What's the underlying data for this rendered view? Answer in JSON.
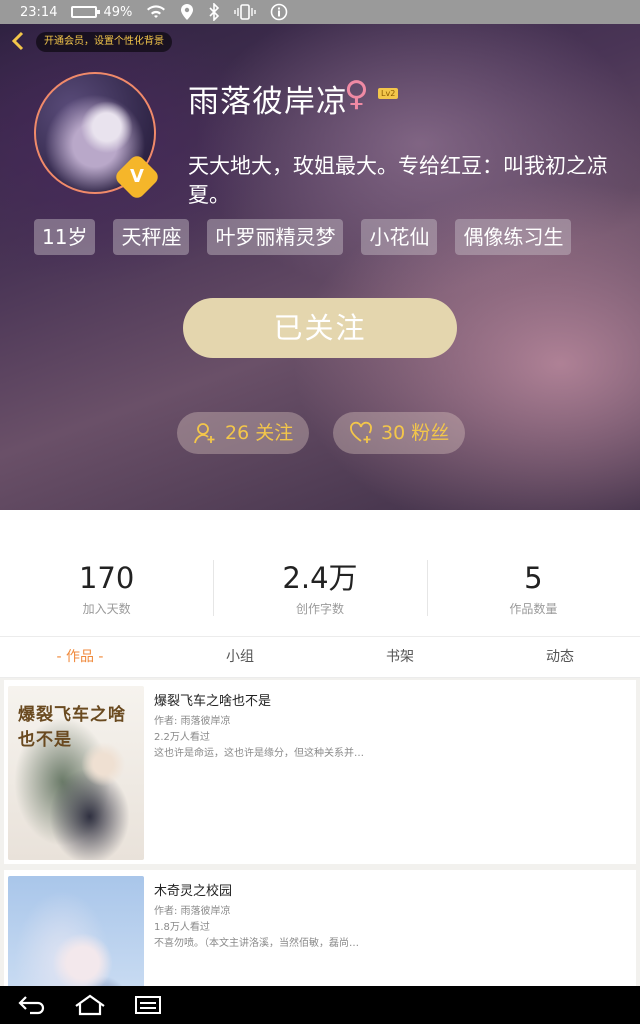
{
  "status_bar": {
    "time": "23:14",
    "battery_percent": "49%",
    "battery_level": 0.49,
    "icons": [
      "battery-icon",
      "wifi-icon",
      "location-icon",
      "bluetooth-icon",
      "vibrate-icon",
      "info-icon"
    ]
  },
  "header": {
    "vip_tip": "开通会员，设置个性化背景",
    "username": "雨落彼岸凉",
    "gender_symbol": "♀",
    "level": "Lv2",
    "bio": "天大地大，玫姐最大。专给红豆：叫我初之凉夏。",
    "tags": [
      "11岁",
      "天秤座",
      "叶罗丽精灵梦",
      "小花仙",
      "偶像练习生"
    ],
    "follow_button": "已关注",
    "following_label": "26 关注",
    "fans_label": "30 粉丝",
    "colors": {
      "accent": "#f3c64a",
      "follow_button": "#e4d6ae",
      "avatar_border": "#f08a6a"
    }
  },
  "stats": [
    {
      "value": "170",
      "label": "加入天数"
    },
    {
      "value": "2.4万",
      "label": "创作字数"
    },
    {
      "value": "5",
      "label": "作品数量"
    }
  ],
  "tabs": [
    {
      "label": "- 作品 -",
      "active": true
    },
    {
      "label": "小组",
      "active": false
    },
    {
      "label": "书架",
      "active": false
    },
    {
      "label": "动态",
      "active": false
    }
  ],
  "works": [
    {
      "cover_text": "爆裂飞车之啥也不是",
      "title": "爆裂飞车之啥也不是",
      "author": "作者: 雨落彼岸凉",
      "views": "2.2万人看过",
      "desc": "这也许是命运，这也许是缘分，但这种关系并…"
    },
    {
      "title": "木奇灵之校园",
      "author": "作者: 雨落彼岸凉",
      "views": "1.8万人看过",
      "desc": "不喜勿喷。（本文主讲洛溪，当然佰敏，磊尚…"
    }
  ],
  "nav_bar": {
    "icons": [
      "back-icon",
      "home-icon",
      "recent-apps-icon"
    ]
  }
}
